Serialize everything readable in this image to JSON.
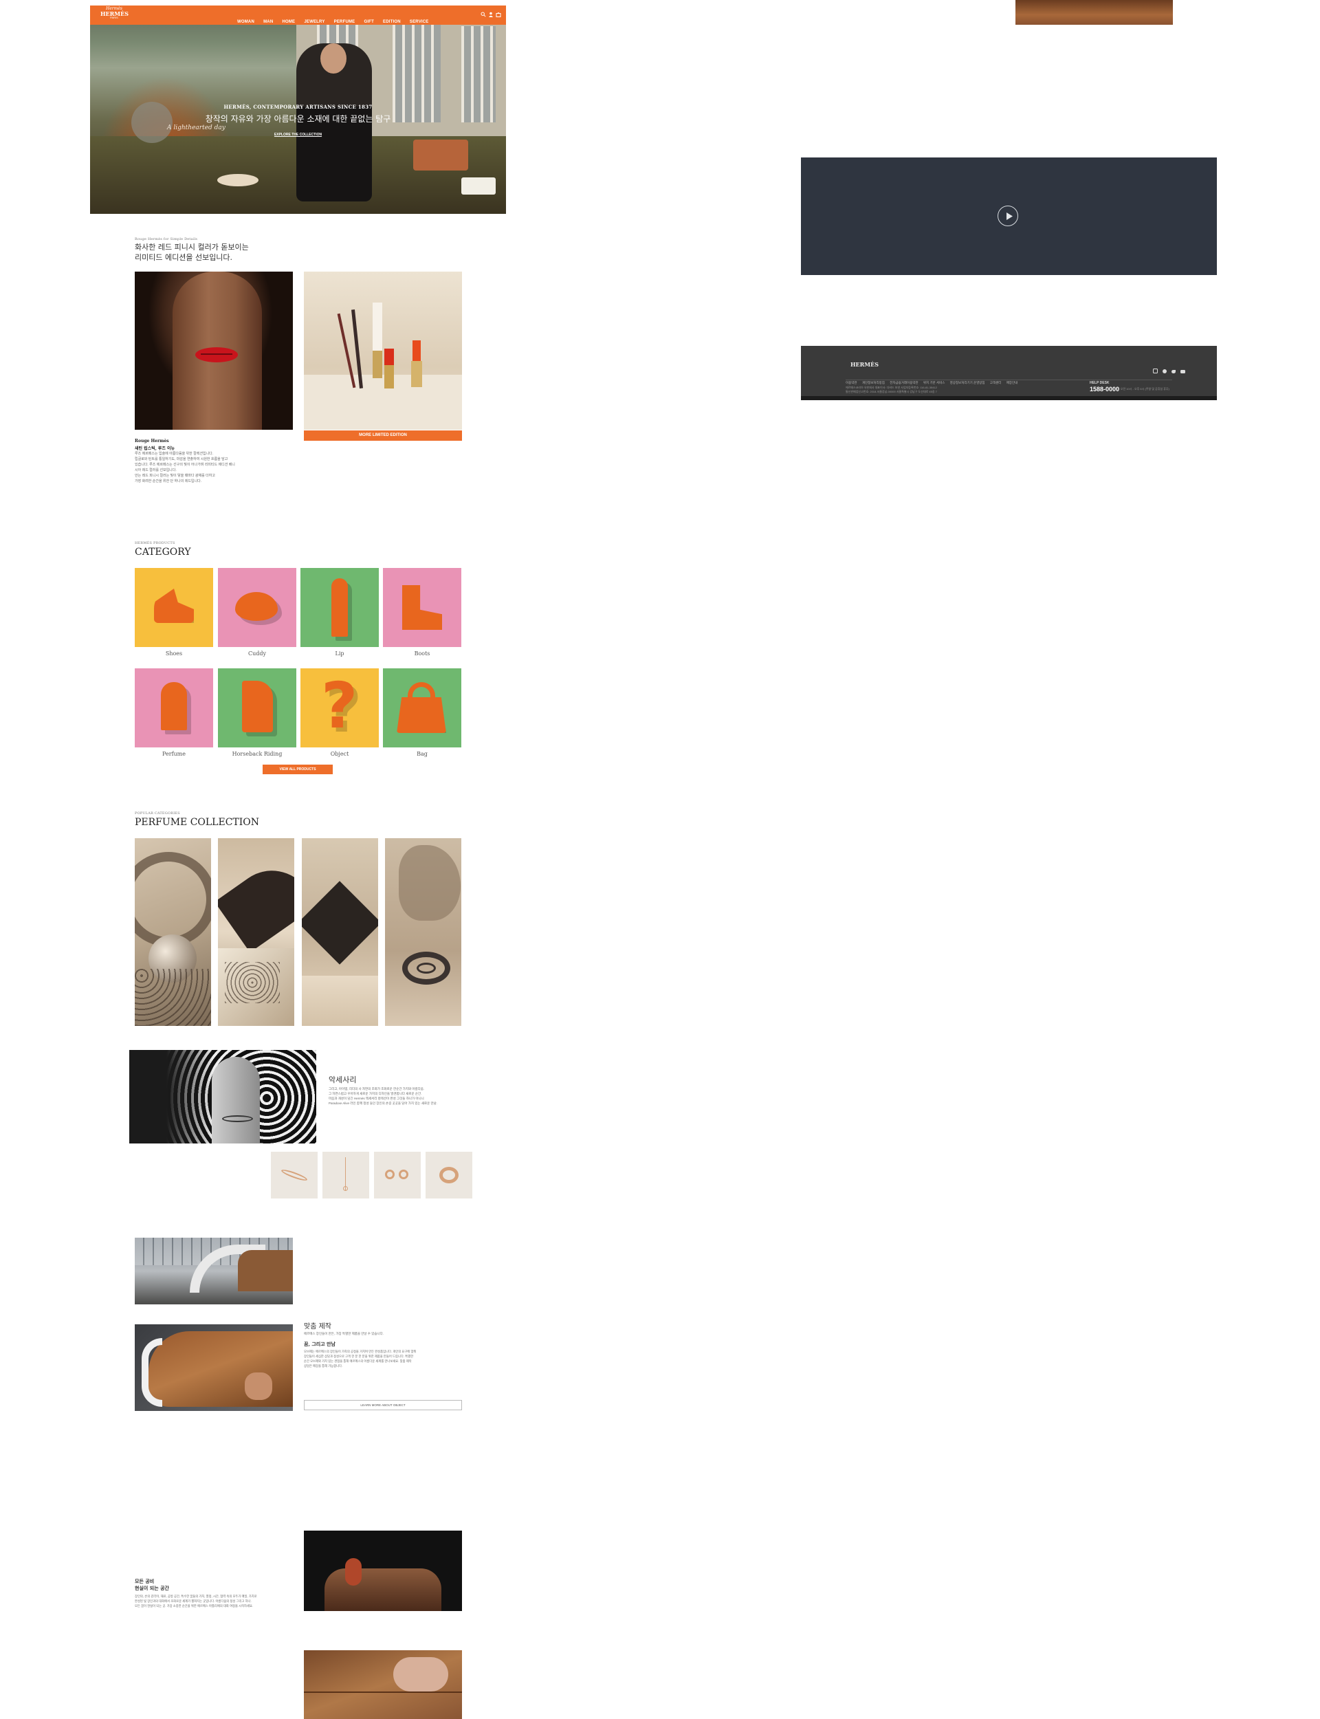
{
  "header": {
    "logo_line1": "Hermès",
    "logo_line2": "HERMÈS",
    "logo_line3": "PARIS",
    "nav": [
      "WOMAN",
      "MAN",
      "HOME",
      "JEWELRY",
      "PERFUME",
      "GIFT",
      "EDITION",
      "SERVICE"
    ],
    "icons": [
      "search-icon",
      "user-icon",
      "bag-icon"
    ]
  },
  "hero": {
    "kicker": "HERMÈS, CONTEMPORARY ARTISANS SINCE 1837",
    "headline": "창작의 자유와 가장 아름다운 소재에 대한 끝없는 탐구",
    "caption": "A lighthearted day",
    "cta": "EXPLORE THE COLLECTION"
  },
  "lipstick": {
    "kicker": "Rouge Hermès for Simple Details",
    "heading_line1": "화사한 레드 피니시 컬러가 돋보이는",
    "heading_line2": "리미티드 에디션을 선보입니다.",
    "product_name": "Rouge Hermès",
    "product_sub": "새틴 립스틱, 루즈 이뉴",
    "desc": [
      "루즈 에르메스는 입술에 아름다움을 위한 컬렉션입니다.",
      "립글로와 틴트를 통일하기도, 마감을 연출하여 시원한 흐름을 담고",
      "있습니다. 루즈 에르메스는 선구의 빛이 어나가며 리미티드 에디션 베니",
      "시아 레드 컬러를 선보입니다.",
      "안는 레드 피니시 컬러는 빛이 닿을 때마다 광채를 더하고",
      "가장 화려한 순간을 위한 단 하나의 레드입니다."
    ],
    "button": "MORE LIMITED EDITION"
  },
  "category": {
    "kicker": "HERMÈS PRODUCTS",
    "title": "CATEGORY",
    "items": [
      "Shoes",
      "Cuddy",
      "Lip",
      "Boots",
      "Perfume",
      "Horseback Riding",
      "Object",
      "Bag"
    ],
    "button": "VIEW ALL PRODUCTS"
  },
  "perfume": {
    "kicker": "POPULAR CATEGORIES",
    "title": "PERFUME COLLECTION"
  },
  "accessory": {
    "title": "악세사리",
    "desc": [
      "그리고, 아이템, 리더의 사 자연의 조화가 조화로운 한순간 가치와 아름다움.",
      "그 자연스럽고 우아하게 새로운 가치의 디자인을 발견합니다 새로운 순간.",
      "마음과 개성이 담긴 Hermès 액세서리 컬렉션이 완성 그것들 하나가 아니니",
      "Paradoxe Alive 라인 함께 정성 들인 장인의 손길 곳곳을 담아 가치 있는 새로운 만남."
    ],
    "products": [
      "bracelet",
      "necklace",
      "earrings",
      "ring"
    ]
  },
  "made_to_order": {
    "title": "맞춤 제작",
    "kicker": "에르메스 장인들이 만든, 가장 특별한 제품을 만날 수 있습니다.",
    "subtitle": "꿈, 그리고 만남",
    "desc": [
      "오브제는 에르메스의 장인들이 가죽의 공정을 거치며 만든 완성품입니다. 개인의 요구에 맞춰",
      "장인들이 세심한 상담과 정성으로 고객 한 분 한 분을 위한 제품을 만들어 드립니다. 특별한",
      "순간 오브제와 가치 있는 경험을 통해 에르메스의 아름다운 세계를 만나보세요. 맞춤 제작",
      "상담은 매장을 통해 가능합니다."
    ],
    "button": "LEARN MORE ABOUT OBJECT"
  },
  "craft": {
    "title_line1": "모든 공비",
    "title_line2": "현실이 되는 공간",
    "desc": [
      "장인의, 손의 감각이, 재료, 공방 공간, 특수한 꿈들의 가치, 열정, 시간, 협력 속의 모두가 매일, 가치로",
      "완성된 빛 장인과의 대화에서 조화로운 세계가 펼쳐지는 곳입니다. 아름다움의 정성 그리고 하나.",
      "모든 꿈이 현실이 되는 곳. 가장 소중한 순간을 위한 에르메스 아틀리에의 대화 여정을 시작하세요."
    ]
  },
  "footer": {
    "logo": "HERMÈS",
    "links": [
      "이용약관",
      "개인정보처리방침",
      "전자금융거래이용약관",
      "위치 기반 서비스",
      "영상정보처리기기 운영방침",
      "고객센터",
      "매장안내"
    ],
    "company": [
      "에르메스코리아 유한회사 대표이사: 다비드 보넨 사업자등록번호: 116-81-35412",
      "통신판매업신고번호: 2018-서울강남-00000 서울특별시 강남구 도산대로 45길 7"
    ],
    "help_title": "HELP DESK",
    "help_phone": "1588-0000",
    "help_hours": "월-금 오전 10시 - 오후 6시 (주말 및 공휴일 휴무)",
    "social": [
      "instagram-icon",
      "facebook-icon",
      "twitter-icon",
      "youtube-icon"
    ]
  },
  "colors": {
    "brand_orange": "#ee6e2a",
    "video_bg": "#2f3540",
    "footer_bg": "#3a3a3a"
  }
}
